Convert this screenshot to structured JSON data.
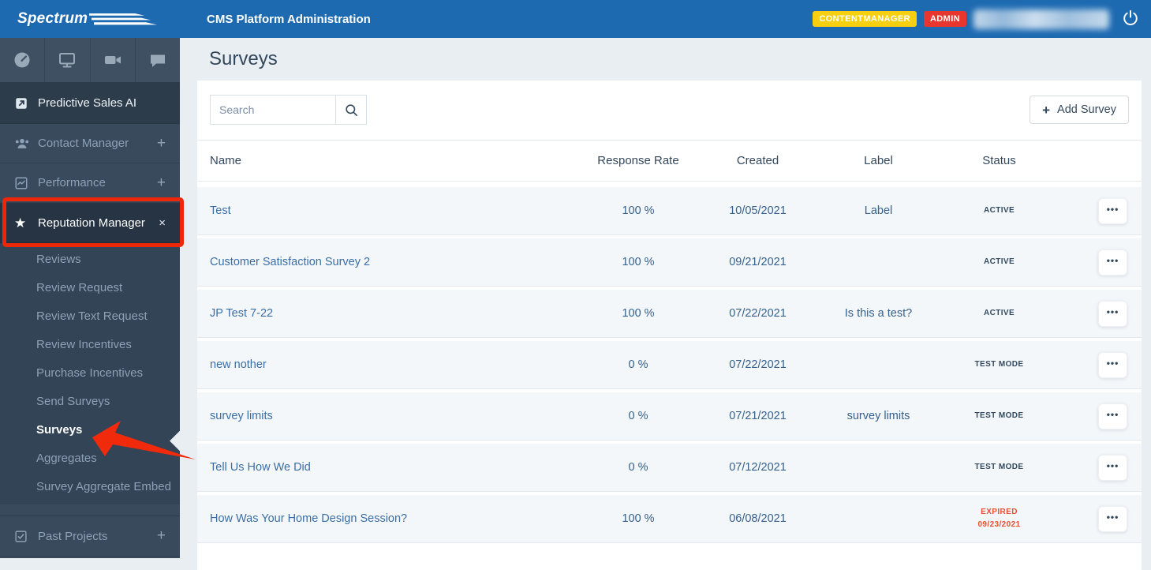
{
  "header": {
    "logo": "Spectrum",
    "title": "CMS Platform Administration",
    "badges": [
      {
        "label": "CONTENTMANAGER",
        "color": "#f7cf11"
      },
      {
        "label": "ADMIN",
        "color": "#e8352e"
      }
    ]
  },
  "colors": {
    "header_blue": "#1d6ab1",
    "sidebar_dark": "#384a5c",
    "annotation_red": "#ee2708",
    "link_blue": "#3a6ea5",
    "expired_red": "#e8502f"
  },
  "icons": {
    "top_strip": [
      "gauge-icon",
      "monitor-icon",
      "video-camera-icon",
      "chat-icon"
    ],
    "header": [
      "power-icon"
    ],
    "toolbar": [
      "search-icon",
      "plus-icon"
    ]
  },
  "sidebar": {
    "items": [
      {
        "label": "Predictive Sales AI",
        "suffix": ""
      },
      {
        "label": "Contact Manager",
        "suffix": "+"
      },
      {
        "label": "Performance",
        "suffix": "+"
      },
      {
        "label": "Reputation Manager",
        "suffix": "×"
      },
      {
        "label": "Past Projects",
        "suffix": "+"
      }
    ],
    "submenu": [
      "Reviews",
      "Review Request",
      "Review Text Request",
      "Review Incentives",
      "Purchase Incentives",
      "Send Surveys",
      "Surveys",
      "Aggregates",
      "Survey Aggregate Embed"
    ],
    "active_submenu": "Surveys"
  },
  "main": {
    "title": "Surveys",
    "search_placeholder": "Search",
    "add_button_label": "Add Survey",
    "table": {
      "columns": [
        "Name",
        "Response Rate",
        "Created",
        "Label",
        "Status"
      ],
      "rows": [
        {
          "name": "Test",
          "response_rate": "100 %",
          "created": "10/05/2021",
          "label": "Label",
          "status": "ACTIVE",
          "status_date": ""
        },
        {
          "name": "Customer Satisfaction Survey 2",
          "response_rate": "100 %",
          "created": "09/21/2021",
          "label": "",
          "status": "ACTIVE",
          "status_date": ""
        },
        {
          "name": "JP Test 7-22",
          "response_rate": "100 %",
          "created": "07/22/2021",
          "label": "Is this a test?",
          "status": "ACTIVE",
          "status_date": ""
        },
        {
          "name": "new nother",
          "response_rate": "0 %",
          "created": "07/22/2021",
          "label": "",
          "status": "TEST MODE",
          "status_date": ""
        },
        {
          "name": "survey limits",
          "response_rate": "0 %",
          "created": "07/21/2021",
          "label": "survey limits",
          "status": "TEST MODE",
          "status_date": ""
        },
        {
          "name": "Tell Us How We Did",
          "response_rate": "0 %",
          "created": "07/12/2021",
          "label": "",
          "status": "TEST MODE",
          "status_date": ""
        },
        {
          "name": "How Was Your Home Design Session?",
          "response_rate": "100 %",
          "created": "06/08/2021",
          "label": "",
          "status": "EXPIRED",
          "status_date": "09/23/2021"
        }
      ]
    }
  }
}
